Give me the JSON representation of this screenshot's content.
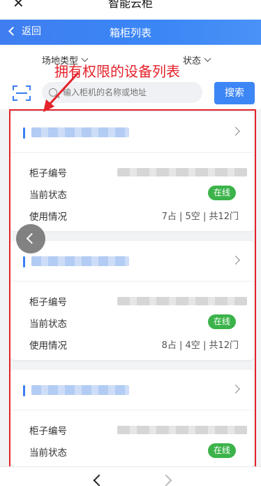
{
  "system": {
    "back_glyph": "✕",
    "title": "智能云柜"
  },
  "header": {
    "back_label": "返回",
    "title": "箱柜列表"
  },
  "filters": {
    "site_type": "场地类型",
    "status": "状态"
  },
  "annotation": {
    "text": "拥有权限的设备列表",
    "color": "#e4222a"
  },
  "search": {
    "placeholder": "输入柜机的名称或地址",
    "button": "搜索"
  },
  "labels": {
    "cabinet_no": "柜子编号",
    "current_status": "当前状态",
    "usage": "使用情况"
  },
  "cards": [
    {
      "status": "在线",
      "usage": "7占 | 5空 | 共12门"
    },
    {
      "status": "在线",
      "usage": "8占 | 4空 | 共12门"
    },
    {
      "status": "在线"
    }
  ],
  "colors": {
    "accent": "#3d86f5",
    "online": "#3bb34a"
  }
}
